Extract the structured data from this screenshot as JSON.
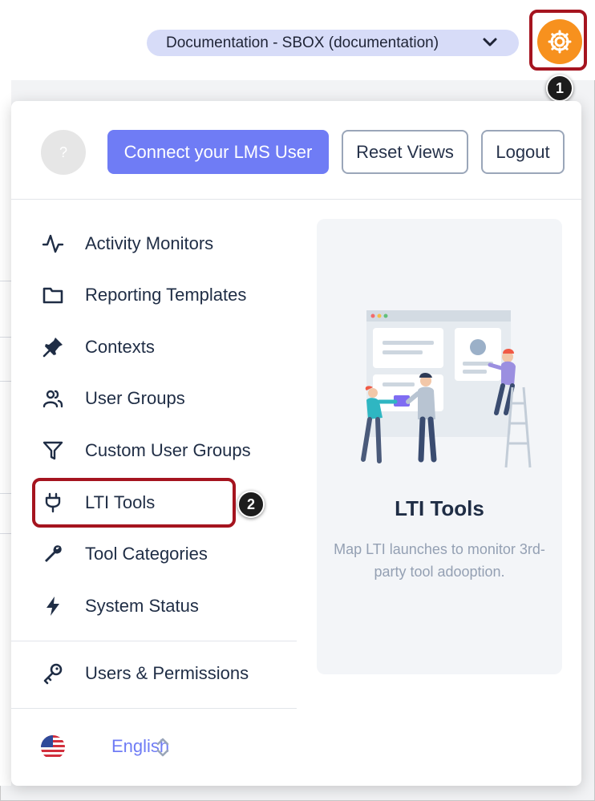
{
  "header": {
    "account_label": "Documentation - SBOX (documentation)",
    "settings_icon": "gear-icon",
    "step1": "1"
  },
  "menu": {
    "avatar_text": "?",
    "connect_label": "Connect your LMS User",
    "reset_label": "Reset Views",
    "logout_label": "Logout",
    "items": [
      {
        "label": "Activity Monitors",
        "icon": "activity-icon"
      },
      {
        "label": "Reporting Templates",
        "icon": "folder-icon"
      },
      {
        "label": "Contexts",
        "icon": "pin-icon"
      },
      {
        "label": "User Groups",
        "icon": "users-icon"
      },
      {
        "label": "Custom User Groups",
        "icon": "filter-icon"
      },
      {
        "label": "LTI Tools",
        "icon": "plug-icon"
      },
      {
        "label": "Tool Categories",
        "icon": "wrench-icon"
      },
      {
        "label": "System Status",
        "icon": "lightning-icon"
      }
    ],
    "users_permissions": {
      "label": "Users & Permissions",
      "icon": "key-icon"
    },
    "step2": "2",
    "language": {
      "label": "English",
      "icon": "us-flag-icon"
    }
  },
  "preview": {
    "title": "LTI Tools",
    "description": "Map LTI launches to monitor 3rd-party tool adooption."
  },
  "colors": {
    "accent": "#6f7cf5",
    "settings": "#f7911e",
    "callout": "#a5141f"
  }
}
